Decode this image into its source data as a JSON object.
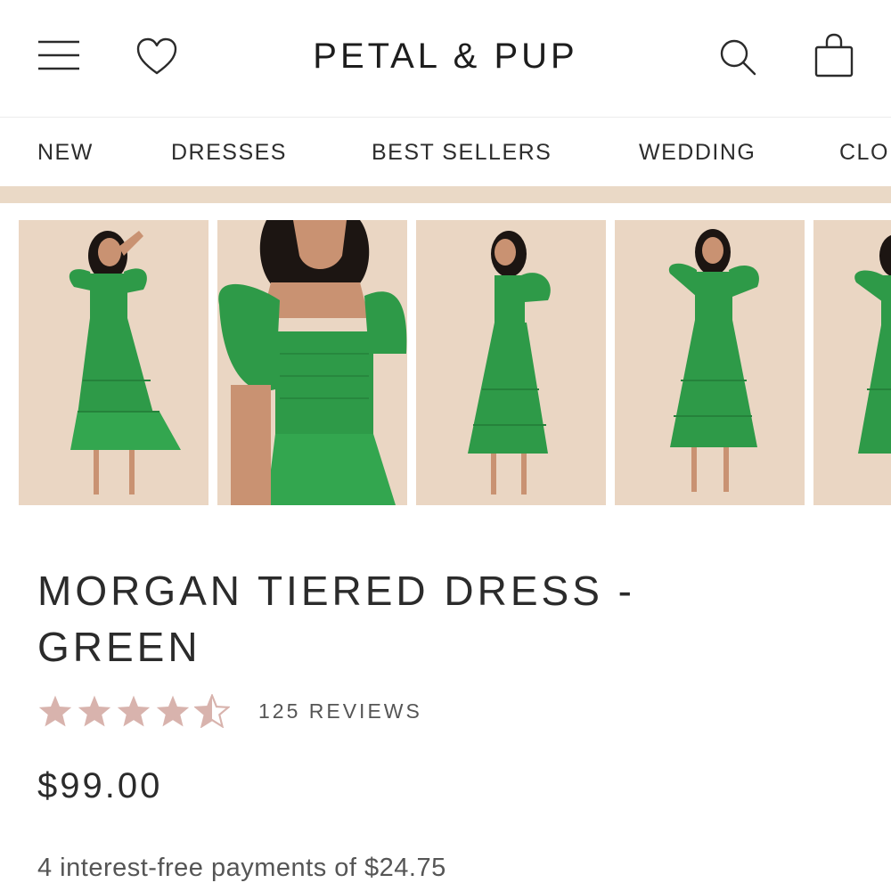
{
  "header": {
    "logo": "PETAL & PUP",
    "icons": [
      "menu-icon",
      "heart-icon",
      "search-icon",
      "shopping-bag-icon"
    ]
  },
  "nav": {
    "items": [
      "NEW",
      "DRESSES",
      "BEST SELLERS",
      "WEDDING",
      "CLO"
    ]
  },
  "product": {
    "title_line1": "MORGAN TIERED DRESS -",
    "title_line2": "GREEN",
    "rating": 4.5,
    "rating_max": 5,
    "reviews": "125 REVIEWS",
    "price": "$99.00",
    "installments": "4 interest-free payments of $24.75"
  },
  "colors": {
    "star": "#d8b3ad",
    "dress": "#2e9a48",
    "photo_bg": "#ead6c3",
    "band": "#ead9c6"
  }
}
